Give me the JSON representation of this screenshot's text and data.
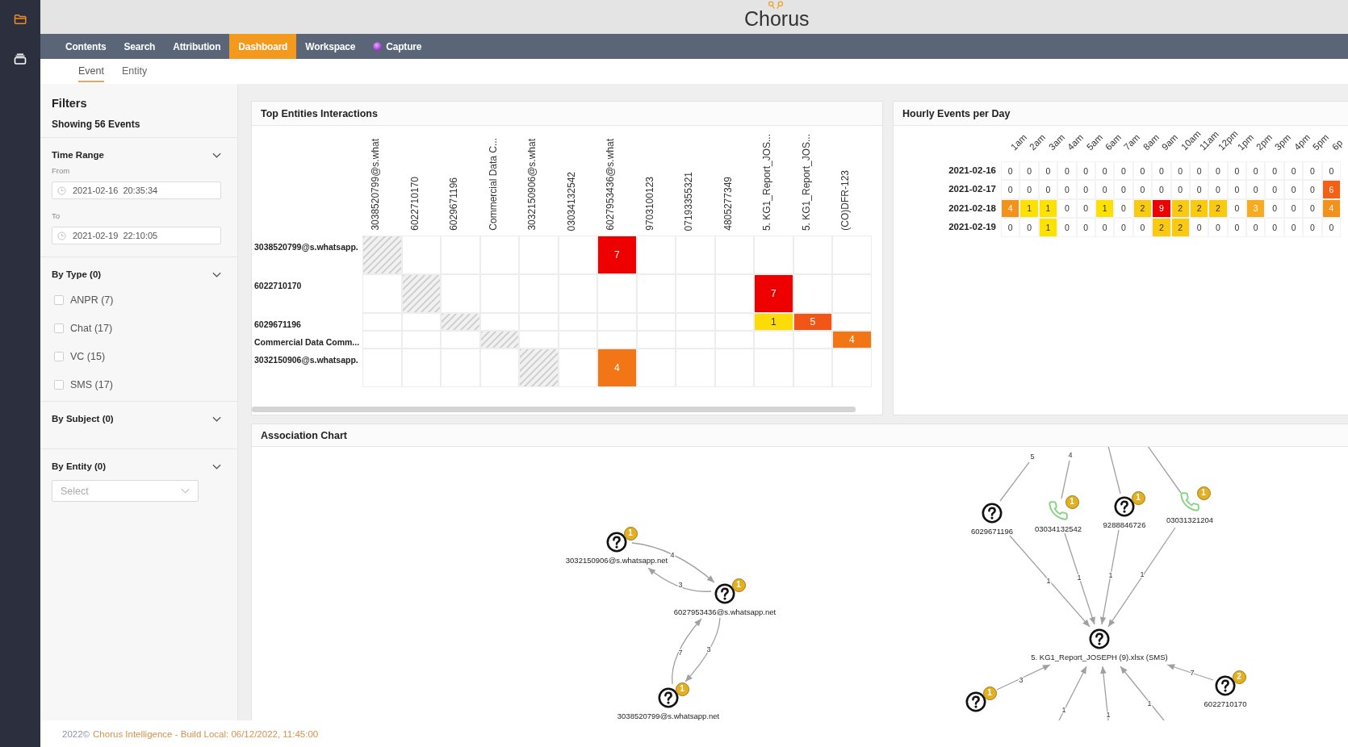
{
  "sidebar": {
    "items": [
      {
        "kind": "folder",
        "selected": true
      },
      {
        "kind": "archive",
        "selected": false
      }
    ]
  },
  "header": {
    "logo": "Chorus"
  },
  "nav": [
    {
      "label": "Contents",
      "selected": false,
      "kind": "plain"
    },
    {
      "label": "Search",
      "selected": false,
      "kind": "plain"
    },
    {
      "label": "Attribution",
      "selected": false,
      "kind": "plain"
    },
    {
      "label": "Dashboard",
      "selected": true,
      "kind": "plain"
    },
    {
      "label": "Workspace",
      "selected": false,
      "kind": "plain"
    },
    {
      "label": "Capture",
      "selected": false,
      "kind": "addon"
    }
  ],
  "subtabs": [
    {
      "label": "Event",
      "selected": true
    },
    {
      "label": "Entity",
      "selected": false
    }
  ],
  "filters": {
    "title": "Filters",
    "summary": "Showing 56 Events",
    "sections": [
      {
        "kind": "range",
        "title": "Time Range",
        "fields": [
          {
            "label": "From",
            "value": "2021-02-16  20:35:34"
          },
          {
            "label": "To",
            "value": "2021-02-19  22:10:05"
          }
        ]
      },
      {
        "kind": "checklist",
        "title": "By Type (0)",
        "options": [
          {
            "label": "ANPR (7)",
            "checked": false
          },
          {
            "label": "Chat (17)",
            "checked": false
          },
          {
            "label": "VC (15)",
            "checked": false
          },
          {
            "label": "SMS (17)",
            "checked": false
          }
        ]
      },
      {
        "kind": "plain",
        "title": "By Subject (0)"
      },
      {
        "kind": "select",
        "title": "By Entity (0)",
        "placeholder": "Select"
      }
    ]
  },
  "top_entities": {
    "title": "Top Entities Interactions",
    "columns": [
      "3038520799@s.what",
      "6022710170",
      "6029671196",
      "Commercial Data C...",
      "3032150906@s.what",
      "03034132542",
      "6027953436@s.what",
      "9703100123",
      "07193355321",
      "4805277349",
      "5. KG1_Report_JOS...",
      "5. KG1_Report_JOS...",
      "(CO)DFR-123"
    ],
    "rows": [
      {
        "label": "3038520799@s.whatsapp.",
        "kind": "tall",
        "cells": [
          {
            "kind": "self"
          },
          {
            "kind": "empty"
          },
          {
            "kind": "empty"
          },
          {
            "kind": "empty"
          },
          {
            "kind": "empty"
          },
          {
            "kind": "empty"
          },
          {
            "kind": "count",
            "value": "7"
          },
          {
            "kind": "empty"
          },
          {
            "kind": "empty"
          },
          {
            "kind": "empty"
          },
          {
            "kind": "empty"
          },
          {
            "kind": "empty"
          },
          {
            "kind": "empty"
          }
        ]
      },
      {
        "label": "6022710170",
        "kind": "tall",
        "cells": [
          {
            "kind": "empty"
          },
          {
            "kind": "self"
          },
          {
            "kind": "empty"
          },
          {
            "kind": "empty"
          },
          {
            "kind": "empty"
          },
          {
            "kind": "empty"
          },
          {
            "kind": "empty"
          },
          {
            "kind": "empty"
          },
          {
            "kind": "empty"
          },
          {
            "kind": "empty"
          },
          {
            "kind": "count",
            "value": "7"
          },
          {
            "kind": "empty"
          },
          {
            "kind": "empty"
          }
        ]
      },
      {
        "label": "6029671196",
        "kind": "short",
        "cells": [
          {
            "kind": "empty"
          },
          {
            "kind": "empty"
          },
          {
            "kind": "self"
          },
          {
            "kind": "empty"
          },
          {
            "kind": "empty"
          },
          {
            "kind": "empty"
          },
          {
            "kind": "empty"
          },
          {
            "kind": "empty"
          },
          {
            "kind": "empty"
          },
          {
            "kind": "empty"
          },
          {
            "kind": "count",
            "value": "1"
          },
          {
            "kind": "count",
            "value": "5"
          },
          {
            "kind": "empty"
          }
        ]
      },
      {
        "label": "Commercial Data Comm...",
        "kind": "short",
        "cells": [
          {
            "kind": "empty"
          },
          {
            "kind": "empty"
          },
          {
            "kind": "empty"
          },
          {
            "kind": "self"
          },
          {
            "kind": "empty"
          },
          {
            "kind": "empty"
          },
          {
            "kind": "empty"
          },
          {
            "kind": "empty"
          },
          {
            "kind": "empty"
          },
          {
            "kind": "empty"
          },
          {
            "kind": "empty"
          },
          {
            "kind": "empty"
          },
          {
            "kind": "count",
            "value": "4"
          }
        ]
      },
      {
        "label": "3032150906@s.whatsapp.",
        "kind": "tall",
        "cells": [
          {
            "kind": "empty"
          },
          {
            "kind": "empty"
          },
          {
            "kind": "empty"
          },
          {
            "kind": "empty"
          },
          {
            "kind": "self"
          },
          {
            "kind": "empty"
          },
          {
            "kind": "count",
            "value": "4"
          },
          {
            "kind": "empty"
          },
          {
            "kind": "empty"
          },
          {
            "kind": "empty"
          },
          {
            "kind": "empty"
          },
          {
            "kind": "empty"
          },
          {
            "kind": "empty"
          }
        ]
      }
    ]
  },
  "hourly_events": {
    "title": "Hourly Events per Day",
    "columns": [
      "1am",
      "2am",
      "3am",
      "4am",
      "5am",
      "6am",
      "7am",
      "8am",
      "9am",
      "10am",
      "11am",
      "12pm",
      "1pm",
      "2pm",
      "3pm",
      "4pm",
      "5pm",
      "6p"
    ],
    "rows": [
      {
        "label": "2021-02-16",
        "values": [
          "0",
          "0",
          "0",
          "0",
          "0",
          "0",
          "0",
          "0",
          "0",
          "0",
          "0",
          "0",
          "0",
          "0",
          "0",
          "0",
          "0",
          "0"
        ]
      },
      {
        "label": "2021-02-17",
        "values": [
          "0",
          "0",
          "0",
          "0",
          "0",
          "0",
          "0",
          "0",
          "0",
          "0",
          "0",
          "0",
          "0",
          "0",
          "0",
          "0",
          "0",
          "6"
        ]
      },
      {
        "label": "2021-02-18",
        "values": [
          "4",
          "1",
          "1",
          "0",
          "0",
          "1",
          "0",
          "2",
          "9",
          "2",
          "2",
          "2",
          "0",
          "3",
          "0",
          "0",
          "0",
          "4"
        ]
      },
      {
        "label": "2021-02-19",
        "values": [
          "0",
          "0",
          "1",
          "0",
          "0",
          "0",
          "0",
          "0",
          "2",
          "2",
          "0",
          "0",
          "0",
          "0",
          "0",
          "0",
          "0",
          "0"
        ]
      }
    ]
  },
  "association_chart": {
    "title": "Association Chart",
    "nodes": [
      {
        "label": "3032150906@s.whatsapp.net",
        "kind": "unknown",
        "badge": "1"
      },
      {
        "label": "6027953436@s.whatsapp.net",
        "kind": "unknown",
        "badge": "1"
      },
      {
        "label": "3038520799@s.whatsapp.net",
        "kind": "unknown",
        "badge": "1"
      },
      {
        "label": "6029671196",
        "kind": "unknown"
      },
      {
        "label": "03034132542",
        "kind": "phone",
        "badge": "1"
      },
      {
        "label": "9288846726",
        "kind": "unknown",
        "badge": "1"
      },
      {
        "label": "03031321204",
        "kind": "phone",
        "badge": "1"
      },
      {
        "label": "5. KG1_Report_JOSEPH (9).xlsx (SMS)",
        "kind": "unknown"
      },
      {
        "kind": "unknown",
        "badge": "1"
      },
      {
        "label": "6022710170",
        "kind": "unknown",
        "badge": "2"
      }
    ],
    "edges": [
      {
        "label": "4",
        "arrow": true
      },
      {
        "label": "3",
        "arrow": true
      },
      {
        "label": "7",
        "arrow": true
      },
      {
        "label": "3",
        "arrow": true
      },
      {
        "label": "5",
        "arrow": false
      },
      {
        "label": "4",
        "arrow": false
      },
      {
        "arrow": false
      },
      {
        "arrow": false
      },
      {
        "label": "1",
        "arrow": true
      },
      {
        "label": "1",
        "arrow": true
      },
      {
        "label": "1",
        "arrow": true
      },
      {
        "label": "1",
        "arrow": true
      },
      {
        "label": "3",
        "arrow": true
      },
      {
        "label": "7",
        "arrow": true
      },
      {
        "label": "1",
        "arrow": true
      },
      {
        "label": "1",
        "arrow": true
      },
      {
        "label": "1",
        "arrow": true
      }
    ]
  },
  "footer": {
    "copyright": "2022©",
    "build": "Chorus Intelligence - Build Local: 06/12/2022, 11:45:00"
  }
}
